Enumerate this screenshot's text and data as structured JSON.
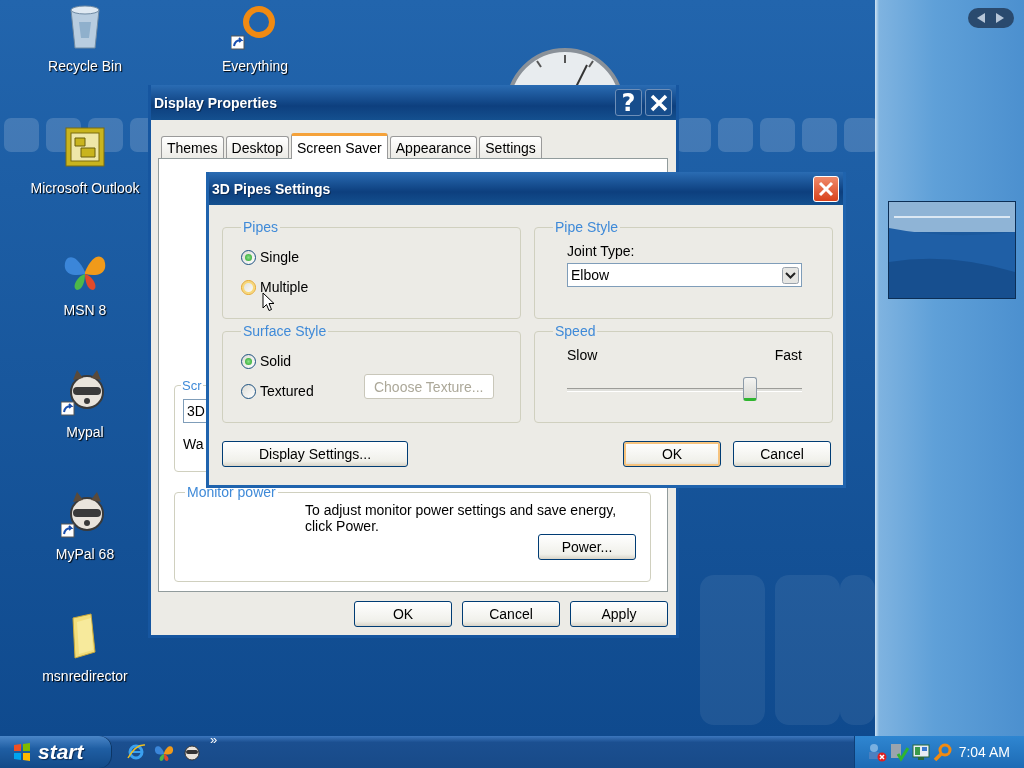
{
  "desktop_icon_columns": [
    [
      {
        "label": "Recycle Bin",
        "kind": "recycle",
        "shortcut": false
      },
      {
        "label": "Microsoft Outlook",
        "kind": "outlook",
        "shortcut": false
      },
      {
        "label": "MSN 8",
        "kind": "butterfly",
        "shortcut": false
      },
      {
        "label": "Mypal",
        "kind": "raccoon",
        "shortcut": true
      },
      {
        "label": "MyPal 68",
        "kind": "raccoon",
        "shortcut": true
      },
      {
        "label": "msnredirector",
        "kind": "folder",
        "shortcut": false
      }
    ],
    [
      {
        "label": "Everything",
        "kind": "ring",
        "shortcut": true
      }
    ]
  ],
  "display_properties": {
    "title": "Display Properties",
    "help": "?",
    "tabs": [
      {
        "label": "Themes",
        "selected": false
      },
      {
        "label": "Desktop",
        "selected": false
      },
      {
        "label": "Screen Saver",
        "selected": true
      },
      {
        "label": "Appearance",
        "selected": false
      },
      {
        "label": "Settings",
        "selected": false
      }
    ],
    "screen_saver": {
      "legend": "Scr",
      "value": "3D",
      "wait_label": "Wa"
    },
    "monitor_power": {
      "legend": "Monitor power",
      "text": "To adjust monitor power settings and save energy, click Power.",
      "button": "Power..."
    },
    "buttons": [
      "OK",
      "Cancel",
      "Apply"
    ]
  },
  "pipes_dialog": {
    "title": "3D Pipes Settings",
    "pipes": {
      "legend": "Pipes",
      "options": [
        {
          "label": "Single",
          "selected": true,
          "hovered": false
        },
        {
          "label": "Multiple",
          "selected": false,
          "hovered": true
        }
      ]
    },
    "pipe_style": {
      "legend": "Pipe Style",
      "joint_label": "Joint Type:",
      "joint_value": "Elbow"
    },
    "surface_style": {
      "legend": "Surface Style",
      "options": [
        {
          "label": "Solid",
          "selected": true,
          "hovered": false
        },
        {
          "label": "Textured",
          "selected": false,
          "hovered": false
        }
      ],
      "texture_button": {
        "label": "Choose Texture...",
        "disabled": true
      }
    },
    "speed": {
      "legend": "Speed",
      "min_label": "Slow",
      "max_label": "Fast",
      "level": 0.78
    },
    "buttons": [
      {
        "label": "Display Settings...",
        "default": false
      },
      {
        "label": "OK",
        "default": true
      },
      {
        "label": "Cancel",
        "default": false
      }
    ]
  },
  "taskbar": {
    "start": "start",
    "quick_launch": [
      {
        "kind": "browser"
      },
      {
        "kind": "butterfly"
      },
      {
        "kind": "raccoon"
      }
    ],
    "more": "»",
    "tray": [
      {
        "kind": "network"
      },
      {
        "kind": "shield"
      },
      {
        "kind": "monitor"
      },
      {
        "kind": "search"
      }
    ],
    "clock": "7:04 AM"
  }
}
